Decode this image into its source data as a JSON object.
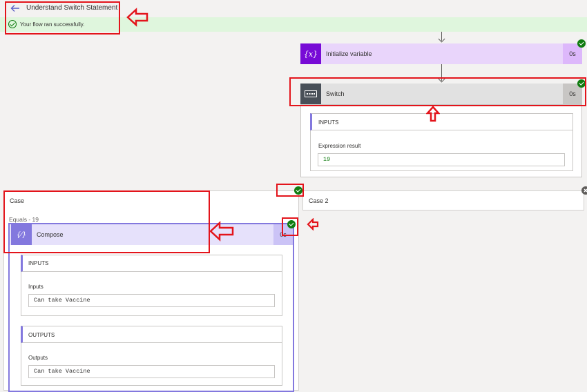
{
  "header": {
    "title": "Understand Switch Statement",
    "status_message": "Your flow ran successfully."
  },
  "initialize_variable": {
    "title": "Initialize variable",
    "icon_glyph": "{x}",
    "duration": "0s",
    "color": "#770bd6"
  },
  "switch": {
    "title": "Switch",
    "duration": "0s",
    "color": "#484f58",
    "inputs_label": "INPUTS",
    "expression_label": "Expression result",
    "expression_value": "19"
  },
  "case": {
    "title": "Case",
    "equals_label": "Equals - 19"
  },
  "case2": {
    "title": "Case 2"
  },
  "compose": {
    "title": "Compose",
    "icon_glyph": "{⁄}",
    "duration": "0s",
    "color": "#8378de",
    "inputs_section": "INPUTS",
    "inputs_label": "Inputs",
    "inputs_value": "Can take Vaccine",
    "outputs_section": "OUTPUTS",
    "outputs_label": "Outputs",
    "outputs_value": "Can take Vaccine"
  },
  "colors": {
    "success": "#107c10",
    "success_bar": "#dff6dd",
    "annotation": "#e3141b"
  }
}
